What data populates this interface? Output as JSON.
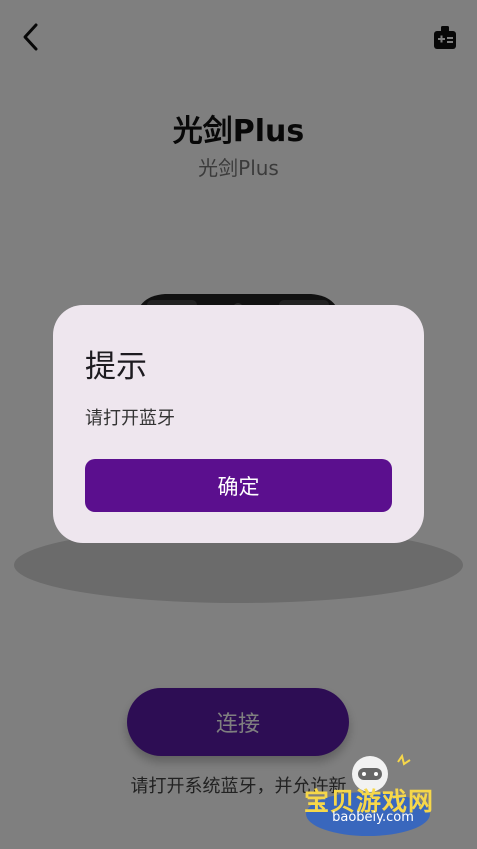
{
  "header": {
    "back_icon": "chevron-left-icon",
    "settings_icon": "device-settings-icon"
  },
  "device": {
    "title": "光剑Plus",
    "subtitle": "光剑Plus"
  },
  "connect": {
    "button_label": "连接",
    "hint": "请打开系统蓝牙，并允许新"
  },
  "dialog": {
    "title": "提示",
    "message": "请打开蓝牙",
    "confirm_label": "确定"
  },
  "watermark": {
    "brand": "宝贝游戏网",
    "site": "baobeiy.com"
  },
  "colors": {
    "accent": "#5b0f8e",
    "dialog_bg": "#eee6ee",
    "connect_button": "#5a1aa8"
  }
}
